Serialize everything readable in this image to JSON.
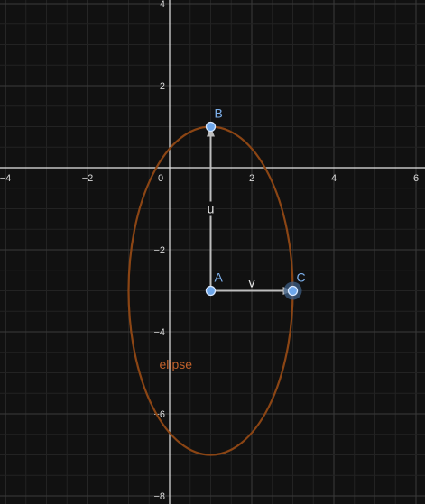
{
  "colors": {
    "background": "#111111",
    "grid_minor": "#232323",
    "grid_major": "#3a3a3a",
    "axis": "#e6e6e6",
    "tick_label": "#d9d9d9",
    "ellipse": "#8b4514",
    "ellipse_label": "#c0602a",
    "vector": "#bdbdbd",
    "point_fill": "#6ea7ea",
    "point_stroke": "#d8e8ff",
    "point_label": "#7fb2ee",
    "selection_halo": "#3e5f86"
  },
  "x_ticks": [
    {
      "value": -4,
      "label": "−4"
    },
    {
      "value": -2,
      "label": "−2"
    },
    {
      "value": 2,
      "label": "2"
    },
    {
      "value": 4,
      "label": "4"
    },
    {
      "value": 6,
      "label": "6"
    }
  ],
  "y_ticks": [
    {
      "value": 4,
      "label": "4"
    },
    {
      "value": 2,
      "label": "2"
    },
    {
      "value": -2,
      "label": "−2"
    },
    {
      "value": -4,
      "label": "−4"
    },
    {
      "value": -6,
      "label": "−6"
    },
    {
      "value": -8,
      "label": "−8"
    }
  ],
  "origin_label": "0",
  "points": [
    {
      "name": "A",
      "x": 1,
      "y": -3,
      "selected": false
    },
    {
      "name": "B",
      "x": 1,
      "y": 1,
      "selected": false
    },
    {
      "name": "C",
      "x": 3,
      "y": -3,
      "selected": true
    }
  ],
  "vectors": [
    {
      "name": "u",
      "from": "A",
      "to": "B"
    },
    {
      "name": "v",
      "from": "A",
      "to": "C"
    }
  ],
  "ellipse": {
    "label": "elipse",
    "center": {
      "x": 1,
      "y": -3
    },
    "semi_axis_x": 2,
    "semi_axis_y": 4
  }
}
